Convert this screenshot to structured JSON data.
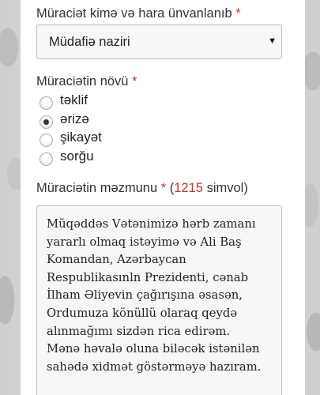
{
  "form": {
    "recipient_label": "Müraciət kimə və hara ünvanlanıb",
    "required_mark": "*",
    "recipient_value": "Müdafiə naziri",
    "type_label": "Müraciətin növü",
    "types": [
      {
        "label": "təklif",
        "checked": false
      },
      {
        "label": "ərizə",
        "checked": true
      },
      {
        "label": "şikayət",
        "checked": false
      },
      {
        "label": "sorğu",
        "checked": false
      }
    ],
    "content_label": "Müraciətin məzmunu",
    "count_open": "(",
    "count_value": "1215",
    "count_unit": "simvol)",
    "content_lines": [
      "Müqəddəs Vətənimizə hərb zamanı",
      "yararlı olmaq istəyimə və Ali Baş",
      "Komandan, Azərbaycan",
      "Respublikasınln Prezidenti, cənab",
      "İlham Əliyevin çağırışına əsasən,",
      "Ordumuza könüllü olaraq qeydə",
      "alınmağımı sizdən rica edirəm.",
      "Mənə həvalə oluna biləcək istənilən",
      "sahədə xidmət göstərməyə hazıram."
    ]
  }
}
